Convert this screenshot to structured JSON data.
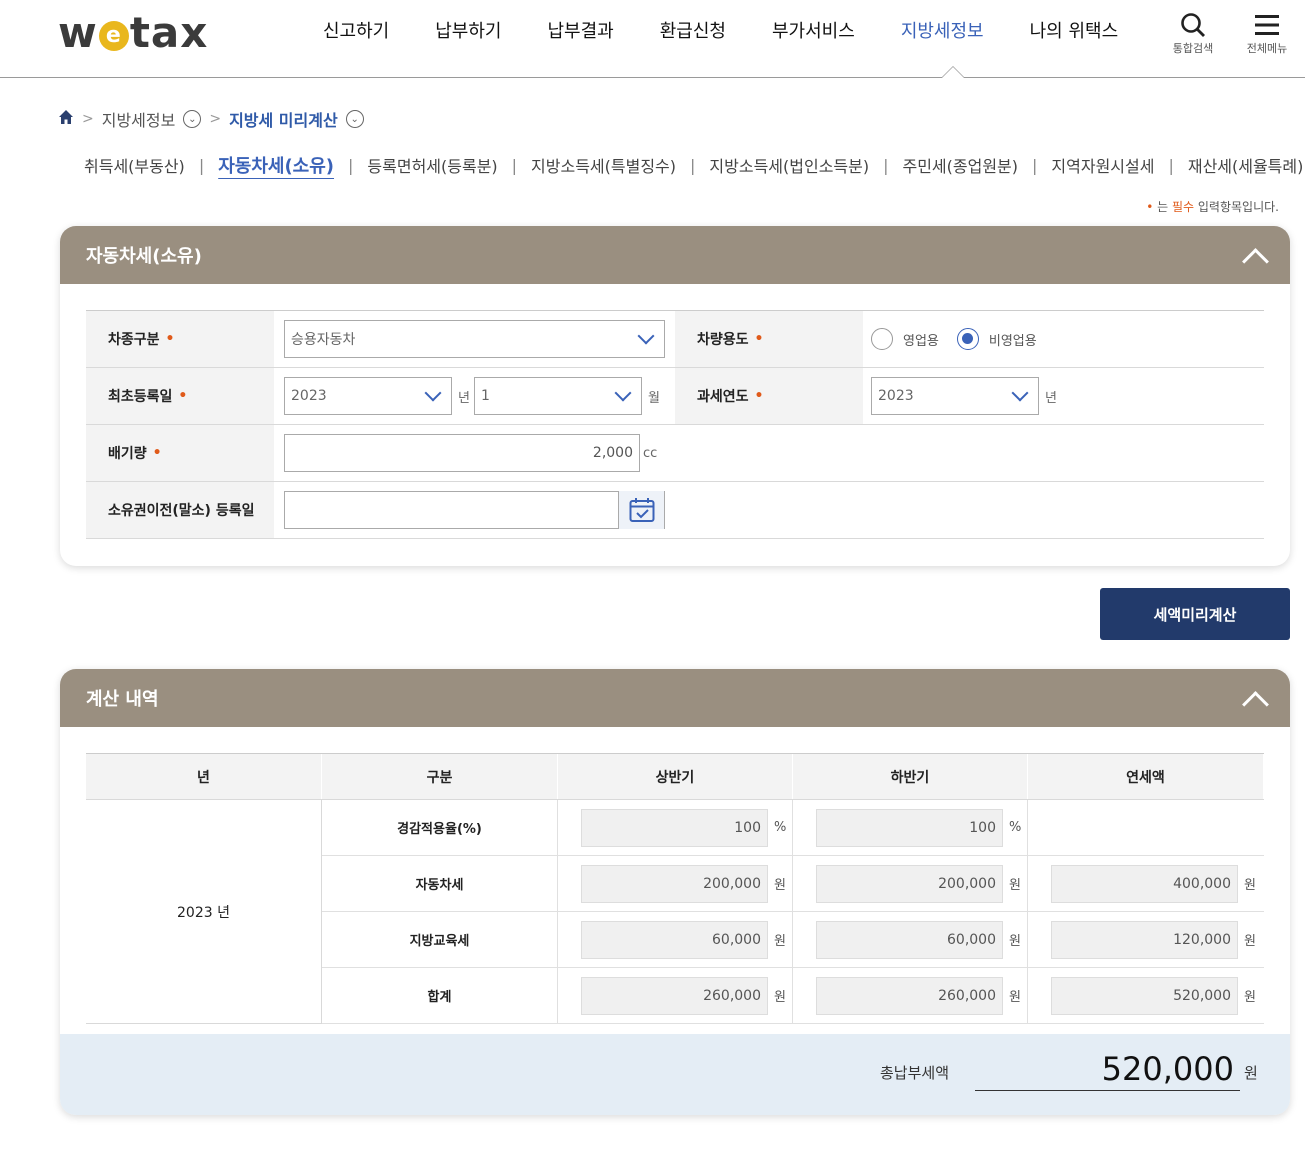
{
  "header": {
    "logo": {
      "pre": "w",
      "mid": "e",
      "post": "tax"
    },
    "nav": [
      "신고하기",
      "납부하기",
      "납부결과",
      "환급신청",
      "부가서비스",
      "지방세정보",
      "나의 위택스"
    ],
    "active_nav": "지방세정보",
    "search_label": "통합검색",
    "menu_label": "전체메뉴"
  },
  "breadcrumb": {
    "level1": "지방세정보",
    "level2": "지방세 미리계산"
  },
  "subtabs": [
    "취득세(부동산)",
    "자동차세(소유)",
    "등록면허세(등록분)",
    "지방소득세(특별징수)",
    "지방소득세(법인소득분)",
    "주민세(종업원분)",
    "지역자원시설세",
    "재산세(세율특례)"
  ],
  "required_note": {
    "dot": "•",
    "pre": " 는 ",
    "strong": "필수",
    "post": " 입력항목입니다."
  },
  "form": {
    "title": "자동차세(소유)",
    "vehicle_type": {
      "label": "차종구분",
      "value": "승용자동차"
    },
    "usage": {
      "label": "차량용도",
      "options": [
        "영업용",
        "비영업용"
      ],
      "selected": "비영업용"
    },
    "first_reg": {
      "label": "최초등록일",
      "year": "2023",
      "year_unit": "년",
      "month": "1",
      "month_unit": "월"
    },
    "tax_year": {
      "label": "과세연도",
      "value": "2023",
      "unit": "년"
    },
    "displacement": {
      "label": "배기량",
      "value": "2,000",
      "unit": "cc"
    },
    "transfer_date": {
      "label": "소유권이전(말소) 등록일",
      "value": ""
    },
    "required_mark": "•"
  },
  "calc_button": "세액미리계산",
  "result": {
    "title": "계산 내역",
    "headers": [
      "년",
      "구분",
      "상반기",
      "하반기",
      "연세액"
    ],
    "year": "2023 년",
    "rows": [
      {
        "label": "경감적용율(%)",
        "first": "100",
        "first_unit": "%",
        "second": "100",
        "second_unit": "%",
        "annual": "",
        "annual_unit": ""
      },
      {
        "label": "자동차세",
        "first": "200,000",
        "first_unit": "원",
        "second": "200,000",
        "second_unit": "원",
        "annual": "400,000",
        "annual_unit": "원"
      },
      {
        "label": "지방교육세",
        "first": "60,000",
        "first_unit": "원",
        "second": "60,000",
        "second_unit": "원",
        "annual": "120,000",
        "annual_unit": "원"
      },
      {
        "label": "합계",
        "first": "260,000",
        "first_unit": "원",
        "second": "260,000",
        "second_unit": "원",
        "annual": "520,000",
        "annual_unit": "원"
      }
    ],
    "total_label": "총납부세액",
    "total_value": "520,000",
    "total_unit": "원"
  },
  "colors": {
    "accent": "#3a62b8",
    "panel_head": "#9a8f80",
    "button": "#223a6b",
    "required": "#e05a1a",
    "total_bg": "#e4edf5"
  }
}
